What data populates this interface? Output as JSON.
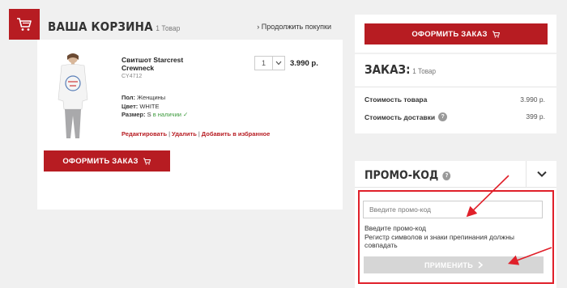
{
  "cart": {
    "title": "ВАША КОРЗИНА",
    "count": "1 Товар",
    "continue_link": "Продолжить покупки"
  },
  "product": {
    "name": "Свитшот Starcrest Crewneck",
    "sku": "CY4712",
    "quantity": "1",
    "price": "3.990 р.",
    "attributes": {
      "gender_label": "Пол:",
      "gender_value": "Женщины",
      "color_label": "Цвет:",
      "color_value": "WHITE",
      "size_label": "Размер:",
      "size_value": "S",
      "stock": "в наличии"
    },
    "actions": {
      "edit": "Редактировать",
      "delete": "Удалить",
      "favorite": "Добавить в избранное"
    }
  },
  "checkout": {
    "label": "ОФОРМИТЬ ЗАКАЗ"
  },
  "order": {
    "title": "ЗАКАЗ:",
    "count": "1 Товар",
    "goods_label": "Стоимость товара",
    "goods_value": "3.990 р.",
    "delivery_label": "Стоимость доставки",
    "delivery_value": "399 р."
  },
  "promo": {
    "title": "ПРОМО-КОД",
    "placeholder": "Введите промо-код",
    "hint_line1": "Введите промо-код",
    "hint_line2": "Регистр символов и знаки препинания должны совпадать",
    "apply_label": "ПРИМЕНИТЬ"
  },
  "colors": {
    "accent": "#b71c22",
    "highlight": "#e0202a",
    "in_stock": "#3c9a3c",
    "disabled_button": "#d6d6d6"
  },
  "icons": [
    "cart-icon",
    "chevron-right-icon",
    "chevron-down-icon",
    "help-icon"
  ]
}
